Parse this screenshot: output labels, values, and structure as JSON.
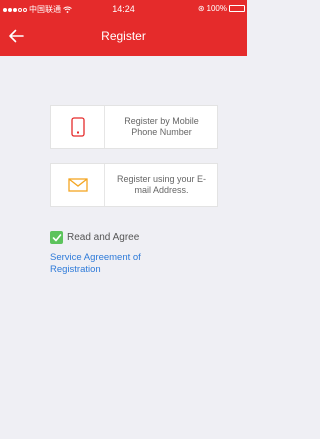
{
  "status_bar": {
    "carrier": "中国联通",
    "time": "14:24",
    "battery": "100%",
    "battery_level": 1.0
  },
  "header": {
    "title": "Register",
    "back_icon": "arrow-left-icon"
  },
  "options": [
    {
      "label": "Register by Mobile Phone Number",
      "icon": "mobile-phone-icon"
    },
    {
      "label": "Register using your E-mail Address.",
      "icon": "envelope-icon"
    }
  ],
  "agreement": {
    "checked": true,
    "agree_text": "Read and Agree",
    "link_text": "Service Agreement of Registration"
  },
  "colors": {
    "header": "#e52b2b",
    "background": "#efeff4",
    "checkbox": "#5cc35c",
    "link": "#2f7bd9",
    "mail_icon": "#f4a623",
    "phone_icon": "#e52b2b"
  }
}
